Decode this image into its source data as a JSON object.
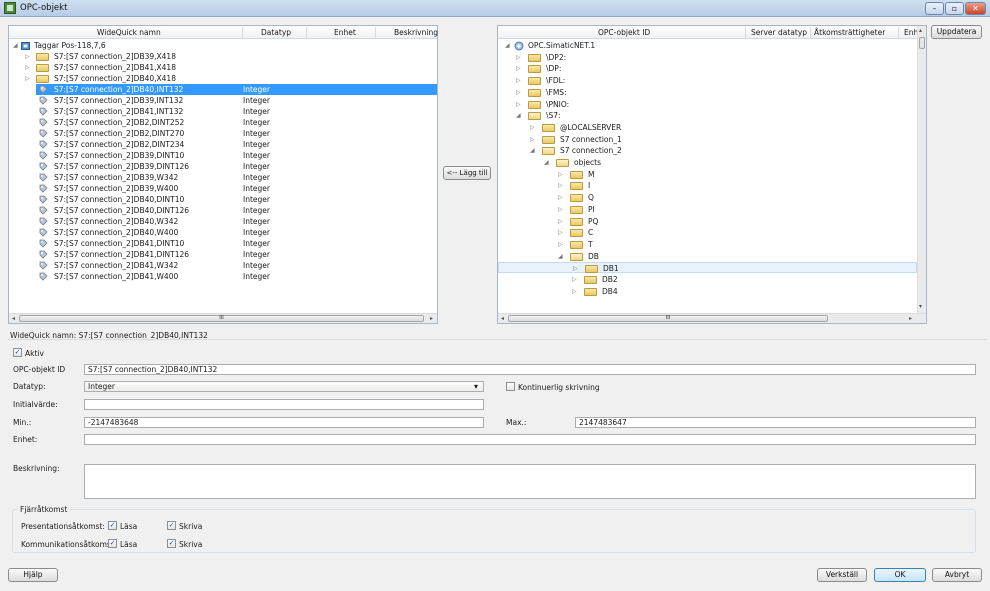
{
  "window": {
    "title": "OPC-objekt"
  },
  "left": {
    "columns": [
      "WideQuick namn",
      "Datatyp",
      "Enhet",
      "Beskrivning"
    ],
    "root": "Taggar Pos-118,7,6",
    "folders": [
      "S7:[S7 connection_2]DB39,X418",
      "S7:[S7 connection_2]DB41,X418",
      "S7:[S7 connection_2]DB40,X418"
    ],
    "items": [
      {
        "name": "S7:[S7 connection_2]DB40,INT132",
        "type": "Integer"
      },
      {
        "name": "S7:[S7 connection_2]DB39,INT132",
        "type": "Integer"
      },
      {
        "name": "S7:[S7 connection_2]DB41,INT132",
        "type": "Integer"
      },
      {
        "name": "S7:[S7 connection_2]DB2,DINT252",
        "type": "Integer"
      },
      {
        "name": "S7:[S7 connection_2]DB2,DINT270",
        "type": "Integer"
      },
      {
        "name": "S7:[S7 connection_2]DB2,DINT234",
        "type": "Integer"
      },
      {
        "name": "S7:[S7 connection_2]DB39,DINT10",
        "type": "Integer"
      },
      {
        "name": "S7:[S7 connection_2]DB39,DINT126",
        "type": "Integer"
      },
      {
        "name": "S7:[S7 connection_2]DB39,W342",
        "type": "Integer"
      },
      {
        "name": "S7:[S7 connection_2]DB39,W400",
        "type": "Integer"
      },
      {
        "name": "S7:[S7 connection_2]DB40,DINT10",
        "type": "Integer"
      },
      {
        "name": "S7:[S7 connection_2]DB40,DINT126",
        "type": "Integer"
      },
      {
        "name": "S7:[S7 connection_2]DB40,W342",
        "type": "Integer"
      },
      {
        "name": "S7:[S7 connection_2]DB40,W400",
        "type": "Integer"
      },
      {
        "name": "S7:[S7 connection_2]DB41,DINT10",
        "type": "Integer"
      },
      {
        "name": "S7:[S7 connection_2]DB41,DINT126",
        "type": "Integer"
      },
      {
        "name": "S7:[S7 connection_2]DB41,W342",
        "type": "Integer"
      },
      {
        "name": "S7:[S7 connection_2]DB41,W400",
        "type": "Integer"
      }
    ],
    "scroll_mark": "III"
  },
  "add_button": "<-- Lägg till",
  "right": {
    "columns": [
      "OPC-objekt ID",
      "Server datatyp",
      "Åtkomsträttigheter",
      "Enh"
    ],
    "root": "OPC.SimaticNET.1",
    "nodes": [
      {
        "label": "\\DP2:",
        "level": 1,
        "expanded": false
      },
      {
        "label": "\\DP:",
        "level": 1,
        "expanded": false
      },
      {
        "label": "\\FDL:",
        "level": 1,
        "expanded": false
      },
      {
        "label": "\\FMS:",
        "level": 1,
        "expanded": false
      },
      {
        "label": "\\PNIO:",
        "level": 1,
        "expanded": false
      },
      {
        "label": "\\S7:",
        "level": 1,
        "expanded": true
      },
      {
        "label": "@LOCALSERVER",
        "level": 2,
        "expanded": false
      },
      {
        "label": "S7 connection_1",
        "level": 2,
        "expanded": false
      },
      {
        "label": "S7 connection_2",
        "level": 2,
        "expanded": true
      },
      {
        "label": "objects",
        "level": 3,
        "expanded": true
      },
      {
        "label": "M",
        "level": 4,
        "expanded": false
      },
      {
        "label": "I",
        "level": 4,
        "expanded": false
      },
      {
        "label": "Q",
        "level": 4,
        "expanded": false
      },
      {
        "label": "PI",
        "level": 4,
        "expanded": false
      },
      {
        "label": "PQ",
        "level": 4,
        "expanded": false
      },
      {
        "label": "C",
        "level": 4,
        "expanded": false
      },
      {
        "label": "T",
        "level": 4,
        "expanded": false
      },
      {
        "label": "DB",
        "level": 4,
        "expanded": true
      },
      {
        "label": "DB1",
        "level": 5,
        "expanded": false
      },
      {
        "label": "DB2",
        "level": 5,
        "expanded": false
      },
      {
        "label": "DB4",
        "level": 5,
        "expanded": false
      }
    ],
    "scroll_mark": "III"
  },
  "update_button": "Uppdatera",
  "details": {
    "name_label": "WideQuick namn: S7:[S7 connection_2]DB40,INT132",
    "active_label": "Aktiv",
    "opc_id_label": "OPC-objekt ID",
    "opc_id_value": "S7:[S7 connection_2]DB40,INT132",
    "datatype_label": "Datatyp:",
    "datatype_value": "Integer",
    "continuous_label": "Kontinuerlig skrivning",
    "initial_label": "Initialvärde:",
    "initial_value": "",
    "min_label": "Min.:",
    "min_value": "-2147483648",
    "max_label": "Max.:",
    "max_value": "2147483647",
    "unit_label": "Enhet:",
    "unit_value": "",
    "desc_label": "Beskrivning:",
    "desc_value": ""
  },
  "remote": {
    "title": "Fjärråtkomst",
    "presentation_label": "Presentationsåtkomst:",
    "communication_label": "Kommunikationsåtkomst:",
    "read_label": "Läsa",
    "write_label": "Skriva"
  },
  "footer": {
    "help": "Hjälp",
    "apply": "Verkställ",
    "ok": "OK",
    "cancel": "Avbryt"
  },
  "icons": {
    "expanded": "◢",
    "collapsed": "▷",
    "check": "✓",
    "dropdown": "▾"
  }
}
